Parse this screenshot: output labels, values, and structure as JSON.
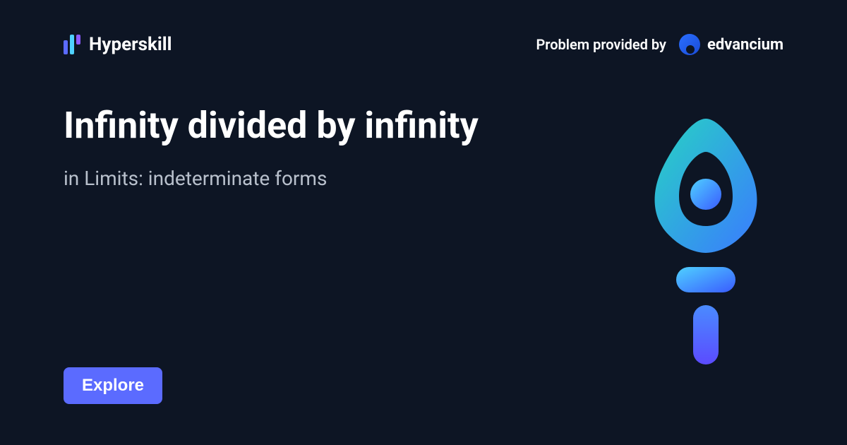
{
  "header": {
    "brand": "Hyperskill",
    "provider_label": "Problem provided by",
    "provider_name": "edvancium"
  },
  "main": {
    "title": "Infinity divided by infinity",
    "subtitle": "in Limits: indeterminate forms",
    "cta": "Explore"
  },
  "colors": {
    "background": "#0d1524",
    "accent": "#5b6bff",
    "subtitle": "#b8c0cc"
  },
  "icons": {
    "hyperskill": "hyperskill-bars-icon",
    "edvancium": "edvancium-circle-icon",
    "torch": "torch-pen-icon"
  }
}
